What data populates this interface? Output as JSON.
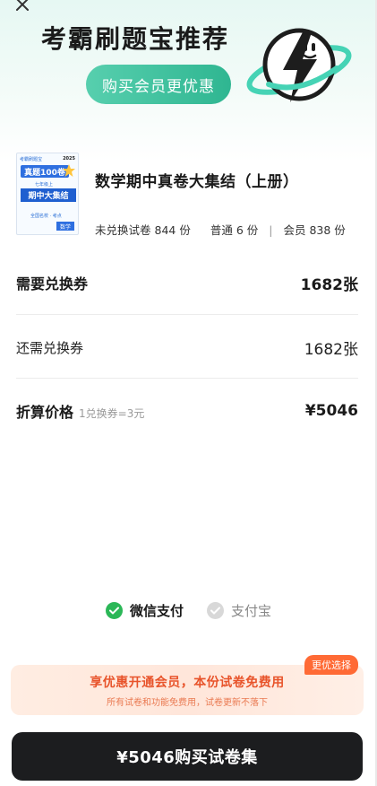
{
  "hero": {
    "title": "考霸刷题宝推荐",
    "promo_label": "购买会员更优惠",
    "accent_color": "#3bbf9a"
  },
  "icons": {
    "close": "close-icon",
    "mascot": "lightning-planet-mascot",
    "wechat_check": "check-icon",
    "alipay_check": "check-icon"
  },
  "product": {
    "title": "数学期中真卷大集结（上册）",
    "cover": {
      "brand": "考霸刷题宝",
      "year": "2025",
      "tag": "真题100卷",
      "grade": "七年级上",
      "name": "期中大集结",
      "line": "全国名校 · 考点",
      "subject": "数学"
    },
    "unredeemed_label": "未兑换试卷",
    "unredeemed_count": "844 份",
    "normal_label": "普通",
    "normal_count": "6 份",
    "separator": "|",
    "member_label": "会员",
    "member_count": "838 份"
  },
  "summary": {
    "required_label": "需要兑换券",
    "required_value": "1682张",
    "remaining_label": "还需兑换券",
    "remaining_value": "1682张",
    "price_label": "折算价格",
    "price_note": "1兑换券=3元",
    "price_value": "¥5046"
  },
  "payment": {
    "wechat_label": "微信支付",
    "wechat_selected": true,
    "alipay_label": "支付宝",
    "alipay_selected": false,
    "selected_color": "#2bb757"
  },
  "member_offer": {
    "badge": "更优选择",
    "title": "享优惠开通会员，本份试卷免费用",
    "subtitle": "所有试卷和功能免费用，试卷更新不落下",
    "accent_color": "#e8542b"
  },
  "buy_button": {
    "label": "¥5046购买试卷集"
  }
}
